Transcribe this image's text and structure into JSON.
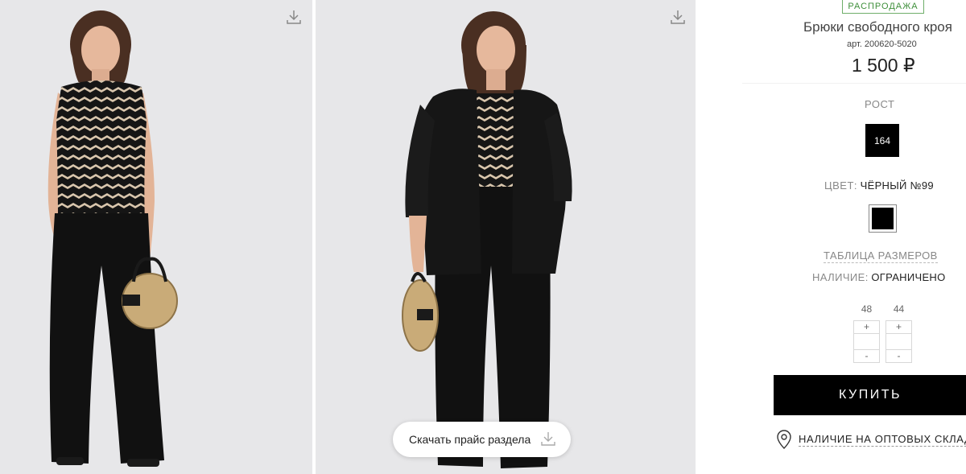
{
  "gallery": {
    "photos": [
      {
        "alt": "model-photo-1",
        "download_icon": "download-icon"
      },
      {
        "alt": "model-photo-2",
        "download_icon": "download-icon"
      }
    ],
    "download_price_label": "Скачать прайс раздела"
  },
  "product": {
    "badge": "РАСПРОДАЖА",
    "title": "Брюки свободного кроя",
    "sku": "арт. 200620-5020",
    "price": "1 500 ₽",
    "height_label": "РОСТ",
    "height_value": "164",
    "color_label": "ЦВЕТ:",
    "color_value": "ЧЁРНЫЙ №99",
    "color_swatch": "#000000",
    "size_table_link": "ТАБЛИЦА РАЗМЕРОВ",
    "availability_label": "НАЛИЧИЕ:",
    "availability_value": "ОГРАНИЧЕНО",
    "sizes": [
      {
        "size": "48",
        "plus": "+",
        "minus": "-",
        "qty": ""
      },
      {
        "size": "44",
        "plus": "+",
        "minus": "-",
        "qty": ""
      }
    ],
    "buy_label": "КУПИТЬ",
    "wholesale_label": "НАЛИЧИЕ НА ОПТОВЫХ СКЛАДАХ"
  },
  "colors": {
    "sale_green": "#3e8f3a",
    "buy_button": "#000000",
    "photo_bg": "#e7e7e9"
  }
}
